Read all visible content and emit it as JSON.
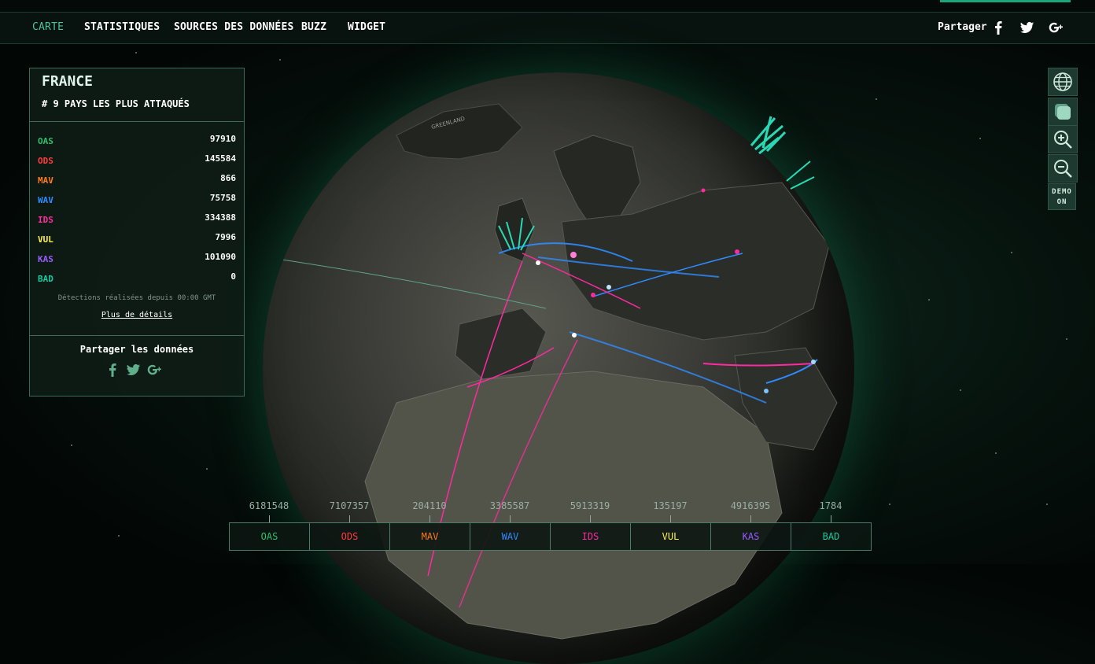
{
  "nav": {
    "items": [
      "CARTE",
      "STATISTIQUES",
      "SOURCES DES DONNÉES",
      "BUZZ",
      "WIDGET"
    ],
    "active": "CARTE",
    "share_label": "Partager"
  },
  "panel": {
    "country": "FRANCE",
    "rank": "# 9 PAYS LES PLUS ATTAQUÉS",
    "stats": [
      {
        "code": "OAS",
        "value": "97910",
        "color": "#2fbf6f"
      },
      {
        "code": "ODS",
        "value": "145584",
        "color": "#ff3b3b"
      },
      {
        "code": "MAV",
        "value": "866",
        "color": "#ff7a1a"
      },
      {
        "code": "WAV",
        "value": "75758",
        "color": "#2f8cff"
      },
      {
        "code": "IDS",
        "value": "334388",
        "color": "#ff2aa0"
      },
      {
        "code": "VUL",
        "value": "7996",
        "color": "#ffef4a"
      },
      {
        "code": "KAS",
        "value": "101090",
        "color": "#9a5cff"
      },
      {
        "code": "BAD",
        "value": "0",
        "color": "#19c9a0"
      }
    ],
    "note": "Détections réalisées depuis 00:00 GMT",
    "details_link": "Plus de détails",
    "share_title": "Partager les données"
  },
  "controls": {
    "demo_label_1": "DEMO",
    "demo_label_2": "ON"
  },
  "globe_labels": {
    "greenland": "GREENLAND"
  },
  "legend": [
    {
      "code": "OAS",
      "count": "6181548",
      "color": "#2fbf6f"
    },
    {
      "code": "ODS",
      "count": "7107357",
      "color": "#ff3b3b"
    },
    {
      "code": "MAV",
      "count": "204110",
      "color": "#ff7a1a"
    },
    {
      "code": "WAV",
      "count": "3385587",
      "color": "#2f8cff"
    },
    {
      "code": "IDS",
      "count": "5913319",
      "color": "#ff2aa0"
    },
    {
      "code": "VUL",
      "count": "135197",
      "color": "#ffef4a"
    },
    {
      "code": "KAS",
      "count": "4916395",
      "color": "#9a5cff"
    },
    {
      "code": "BAD",
      "count": "1784",
      "color": "#19c9a0"
    }
  ]
}
